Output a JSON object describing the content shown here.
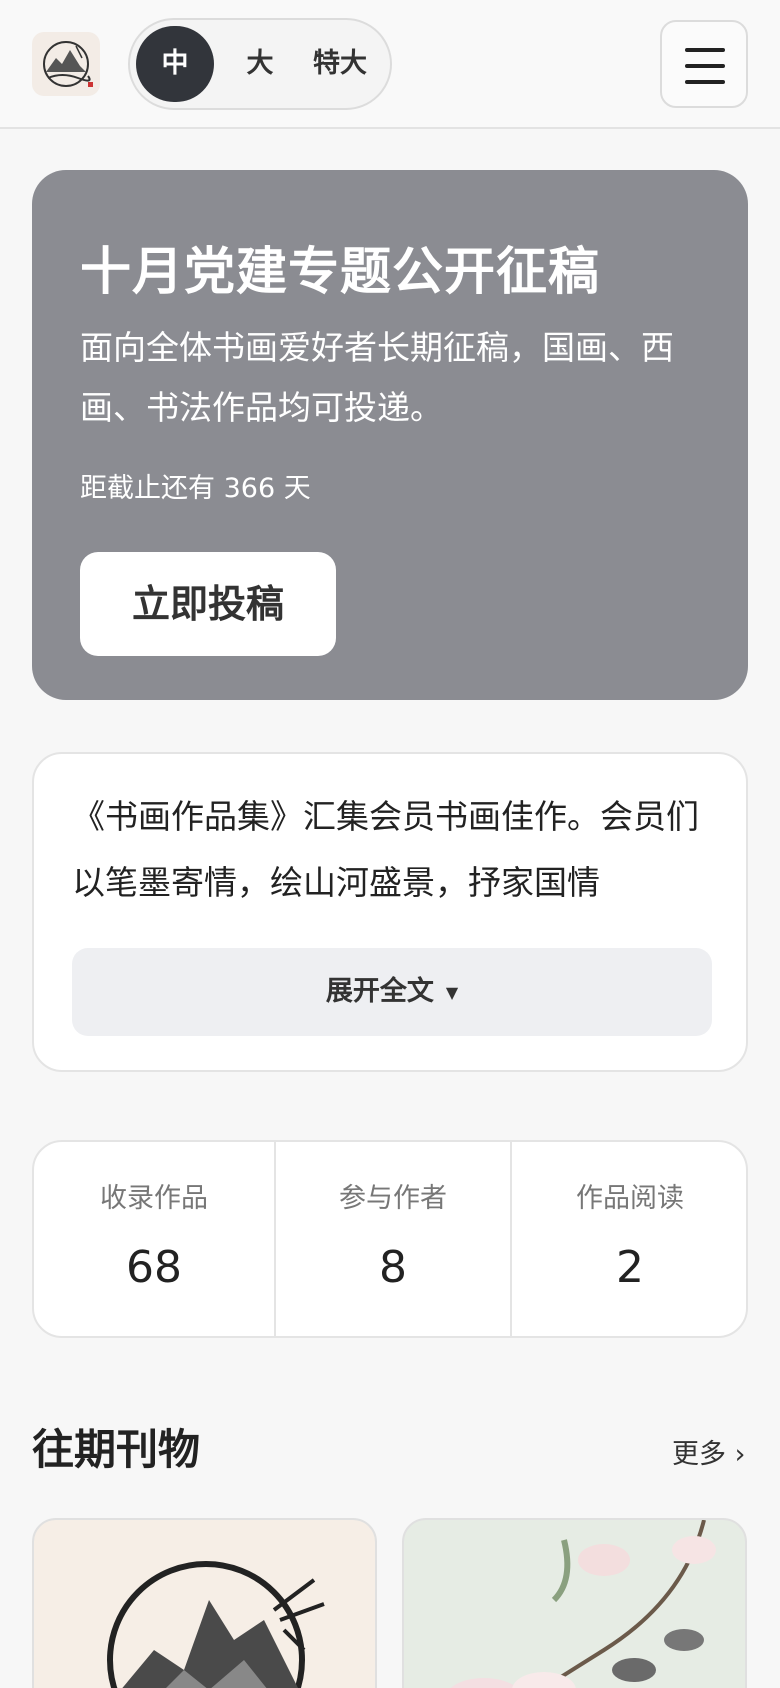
{
  "header": {
    "logo_icon": "ink-mountain-logo-icon",
    "font_sizes": [
      "中",
      "大",
      "特大"
    ],
    "active_font_size": "中",
    "menu_icon": "hamburger-menu-icon"
  },
  "hero": {
    "title": "十月党建专题公开征稿",
    "description": "面向全体书画爱好者长期征稿，国画、西画、书法作品均可投递。",
    "deadline": "距截止还有 366 天",
    "cta_label": "立即投稿",
    "background_color": "#8b8c92"
  },
  "intro": {
    "text": "《书画作品集》汇集会员书画佳作。会员们以笔墨寄情，绘山河盛景，抒家国情",
    "expand_label": "展开全文",
    "expand_icon": "triangle-down-icon"
  },
  "stats": [
    {
      "label": "收录作品",
      "value": "68"
    },
    {
      "label": "参与作者",
      "value": "8"
    },
    {
      "label": "作品阅读",
      "value": "2"
    }
  ],
  "section": {
    "title": "往期刊物",
    "more_label": "更多 ›"
  },
  "journals": [
    {
      "cover_icon": "ink-landscape-bamboo-image"
    },
    {
      "cover_icon": "magnolia-bird-painting-image"
    }
  ]
}
